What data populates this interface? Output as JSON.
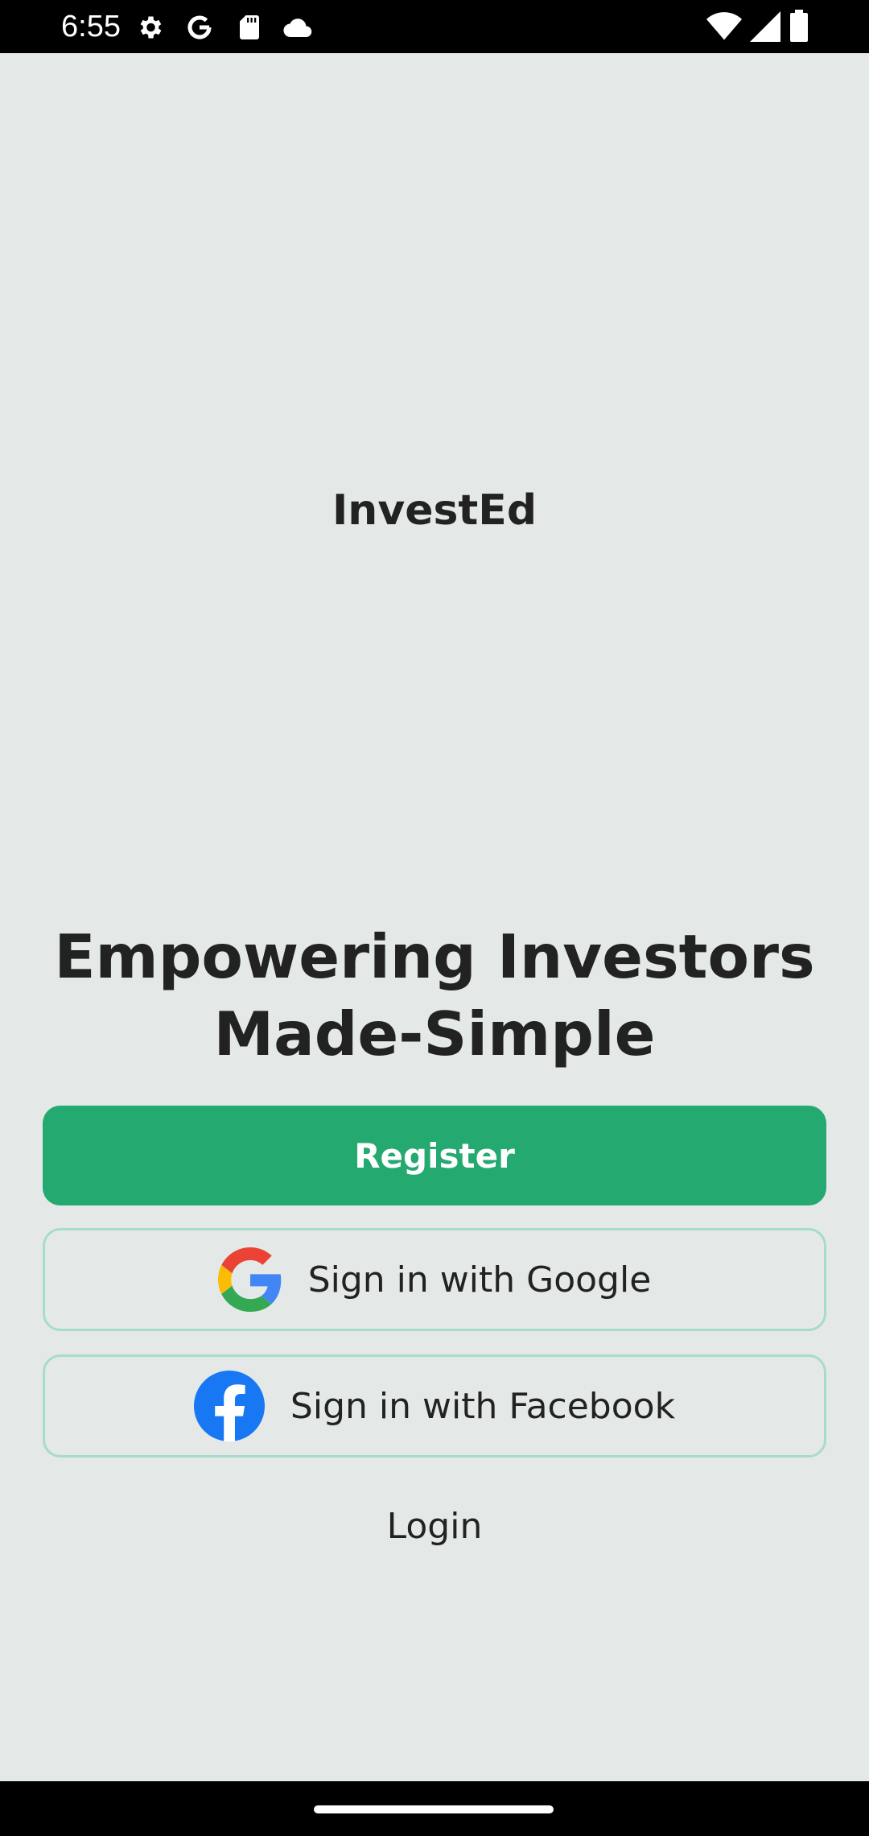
{
  "status_bar": {
    "time": "6:55",
    "left_icons": [
      "gear-icon",
      "google-g-icon",
      "sd-card-icon",
      "cloud-icon"
    ],
    "right_icons": [
      "wifi-icon",
      "cellular-signal-icon",
      "battery-icon"
    ]
  },
  "app": {
    "name": "InvestEd",
    "headline_line1": "Empowering Investors",
    "headline_line2": "Made-Simple"
  },
  "actions": {
    "register_label": "Register",
    "google_label": "Sign in with Google",
    "facebook_label": "Sign in with Facebook",
    "login_label": "Login"
  },
  "colors": {
    "background": "#E4E9E8",
    "primary": "#24A971",
    "outline": "#A7DCC8",
    "text": "#222222"
  }
}
